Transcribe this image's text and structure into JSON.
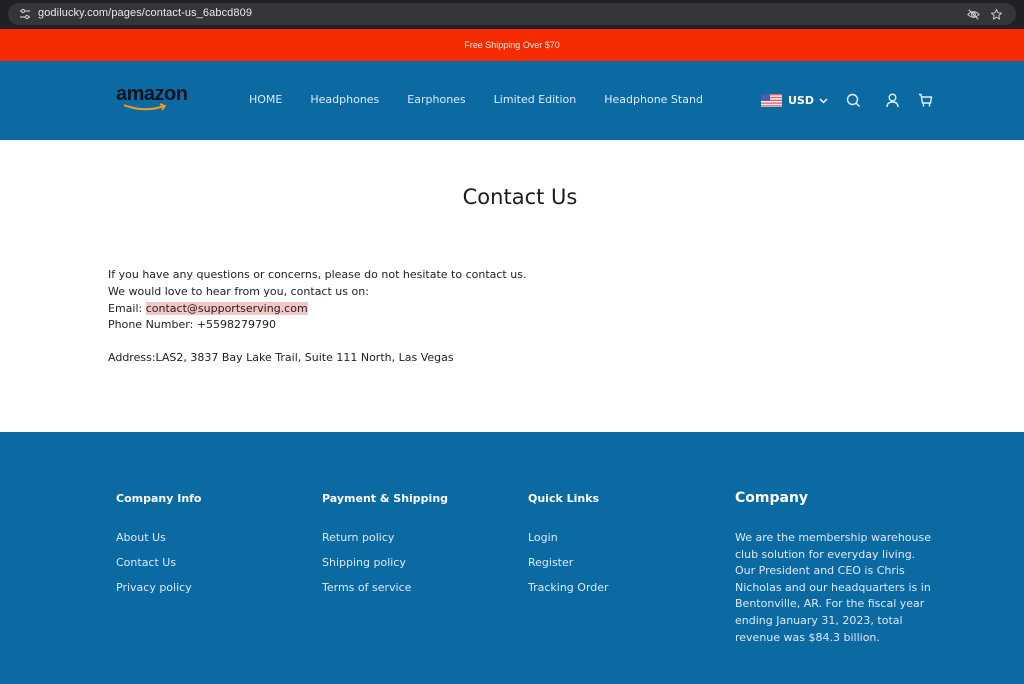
{
  "browser": {
    "url": "godilucky.com/pages/contact-us_6abcd809",
    "icons": [
      "site-info-icon",
      "eye-off-icon",
      "star-bookmark-icon"
    ]
  },
  "announcement": {
    "text": "Free Shipping Over $70",
    "color": "#f52a00"
  },
  "header": {
    "logo_text": "amazon",
    "nav": [
      {
        "label": "HOME"
      },
      {
        "label": "Headphones"
      },
      {
        "label": "Earphones"
      },
      {
        "label": "Limited Edition"
      },
      {
        "label": "Headphone Stand"
      }
    ],
    "currency": "USD",
    "icons": [
      "us-flag-icon",
      "chevron-down-icon",
      "search-icon",
      "account-icon",
      "cart-icon"
    ],
    "color": "#0c6aa3"
  },
  "main": {
    "title": "Contact Us",
    "intro_line1": "If you have any questions or concerns, please do not hesitate to contact us.",
    "intro_line2": "We would love to hear from you, contact us on:",
    "email_label": "Email: ",
    "email": "contact@supportserving.com",
    "phone_label": "Phone Number: ",
    "phone": "+5598279790",
    "address": "Address:LAS2, 3837 Bay Lake Trail, Suite 111 North, Las Vegas"
  },
  "footer": {
    "columns": [
      {
        "title": "Company Info",
        "links": [
          {
            "label": "About Us"
          },
          {
            "label": "Contact Us"
          },
          {
            "label": "Privacy policy"
          }
        ]
      },
      {
        "title": "Payment & Shipping",
        "links": [
          {
            "label": "Return policy"
          },
          {
            "label": "Shipping policy"
          },
          {
            "label": "Terms of service"
          }
        ]
      },
      {
        "title": "Quick Links",
        "links": [
          {
            "label": "Login"
          },
          {
            "label": "Register"
          },
          {
            "label": "Tracking Order"
          }
        ]
      }
    ],
    "company": {
      "title": "Company",
      "text": "We are the membership warehouse club solution for everyday living. Our President and CEO is Chris Nicholas and our headquarters is in Bentonville, AR. For the fiscal year ending January 31, 2023, total revenue was $84.3 billion."
    }
  }
}
